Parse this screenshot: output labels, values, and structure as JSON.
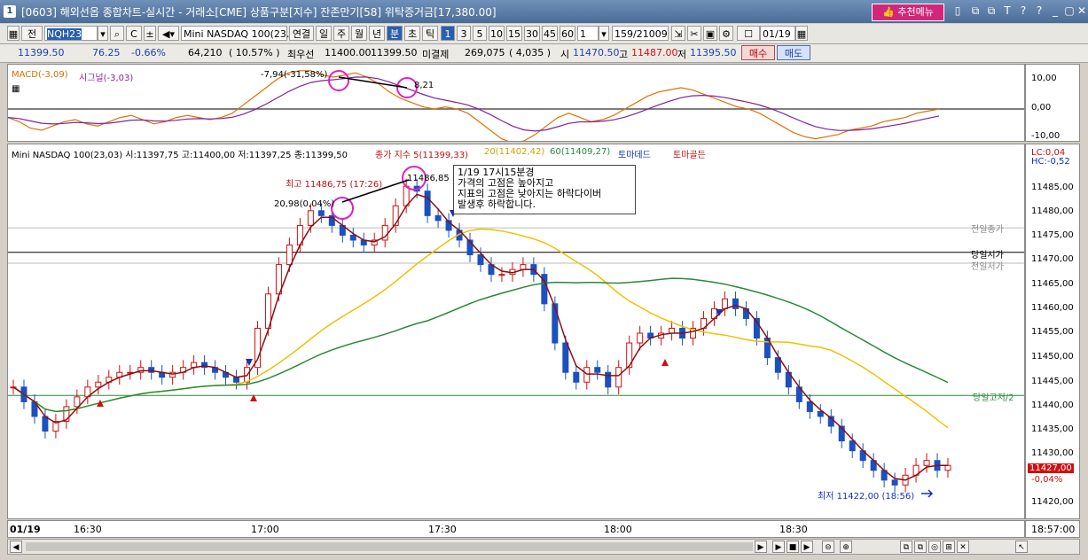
{
  "window": {
    "number": "1",
    "title": "[0603] 해외선옵 종합차트-실시간 - 거래소[CME] 상품구분[지수] 잔존만기[58] 위탁증거금[17,380.00]",
    "recommend_menu": "추천메뉴",
    "controls": [
      "▯",
      "⧉",
      "⧉",
      "T",
      "?",
      "?",
      "_",
      "▢",
      "✕"
    ]
  },
  "toolbar": {
    "jeon": "전",
    "code": "NQH23",
    "instrument": "Mini NASDAQ 100(23.0",
    "type_buttons": [
      "연결",
      "일",
      "주",
      "월",
      "년",
      "분",
      "초",
      "틱"
    ],
    "interval_buttons": [
      "1",
      "3",
      "5",
      "10",
      "15",
      "30",
      "45",
      "60"
    ],
    "count": "1",
    "range": "159/21009",
    "date": "01/19"
  },
  "quote": {
    "price": "11399.50",
    "change": "76.25",
    "change_pct": "-0.66%",
    "volume": "64,210",
    "volume_pct": "( 10.57% )",
    "best_bid_label": "최우선",
    "best_bid": "11400.00",
    "best_ask": "11399.50",
    "open_interest_label": "미결제",
    "open_interest": "269,075",
    "oi_change": "( 4,035 )",
    "open_label": "시",
    "open": "11470.50",
    "high_label": "고",
    "high": "11487.00",
    "low_label": "저",
    "low": "11395.50",
    "buy": "매수",
    "sell": "매도"
  },
  "macd": {
    "legend_macd": "MACD(-3,09)",
    "legend_signal": "시그널(-3,03)",
    "ann_left": "-7,94(-31,58%)",
    "ann_right": "8,21",
    "y_ticks": [
      "10,00",
      "0,00",
      "-10,00"
    ]
  },
  "main": {
    "legend_instrument": "Mini NASDAQ 100(23,03) 시:11397,75 고:11400,00 저:11397,25 종:11399,50",
    "legend_ma5": "종가 지수 5(11399,33)",
    "legend_ma20": "20(11402,42)",
    "legend_ma60": "60(11409,27)",
    "legend_tomato": "토마데드",
    "legend_tomagold": "토마골든",
    "lc": "LC:0,04",
    "hc": "HC:-0,52",
    "high_note": "최고 11486,75 (17:26)",
    "high_value": "11486,85",
    "ratio_note": "20,98(0,04%)",
    "low_note": "최저 11422,00 (18:56)",
    "prev_close": "전일종가",
    "today_open": "당일시가",
    "prev_low": "전일저가",
    "today_mid": "당일고저/2",
    "price_tag": "11427,00",
    "price_pct": "-0,04%",
    "y_ticks": [
      "11485,00",
      "11480,00",
      "11475,00",
      "11470,00",
      "11465,00",
      "11460,00",
      "11455,00",
      "11450,00",
      "11445,00",
      "11440,00",
      "11435,00",
      "11430,00",
      "11420,00"
    ],
    "info_lines": [
      "1/19 17시15분경",
      "가격의 고점은 높아지고",
      "지표의 고점은 낮아지는 하락다이버",
      "발생후 하락합니다."
    ]
  },
  "xaxis": {
    "labels": [
      "01/19",
      "16:30",
      "17:00",
      "17:30",
      "18:00",
      "18:30",
      "18:57:00"
    ]
  },
  "chart_data": {
    "type": "candlestick",
    "y_range": [
      11418,
      11490
    ],
    "series_close": [
      11443,
      11440,
      11437,
      11434,
      11436,
      11439,
      11441,
      11443,
      11444,
      11445,
      11446,
      11446,
      11447,
      11446,
      11445,
      11446,
      11447,
      11448,
      11447,
      11446,
      11445,
      11444,
      11447,
      11455,
      11462,
      11468,
      11472,
      11476,
      11479,
      11478,
      11476,
      11474,
      11473,
      11472,
      11473,
      11476,
      11480,
      11484,
      11483,
      11478,
      11477,
      11475,
      11473,
      11470,
      11468,
      11466,
      11466,
      11467,
      11468,
      11466,
      11460,
      11452,
      11446,
      11444,
      11447,
      11446,
      11443,
      11447,
      11452,
      11454,
      11453,
      11454,
      11455,
      11453,
      11455,
      11457,
      11459,
      11461,
      11459,
      11457,
      11453,
      11449,
      11446,
      11443,
      11440,
      11438,
      11437,
      11435,
      11432,
      11430,
      11428,
      11426,
      11424,
      11423,
      11425,
      11427,
      11428,
      11426,
      11427
    ]
  }
}
